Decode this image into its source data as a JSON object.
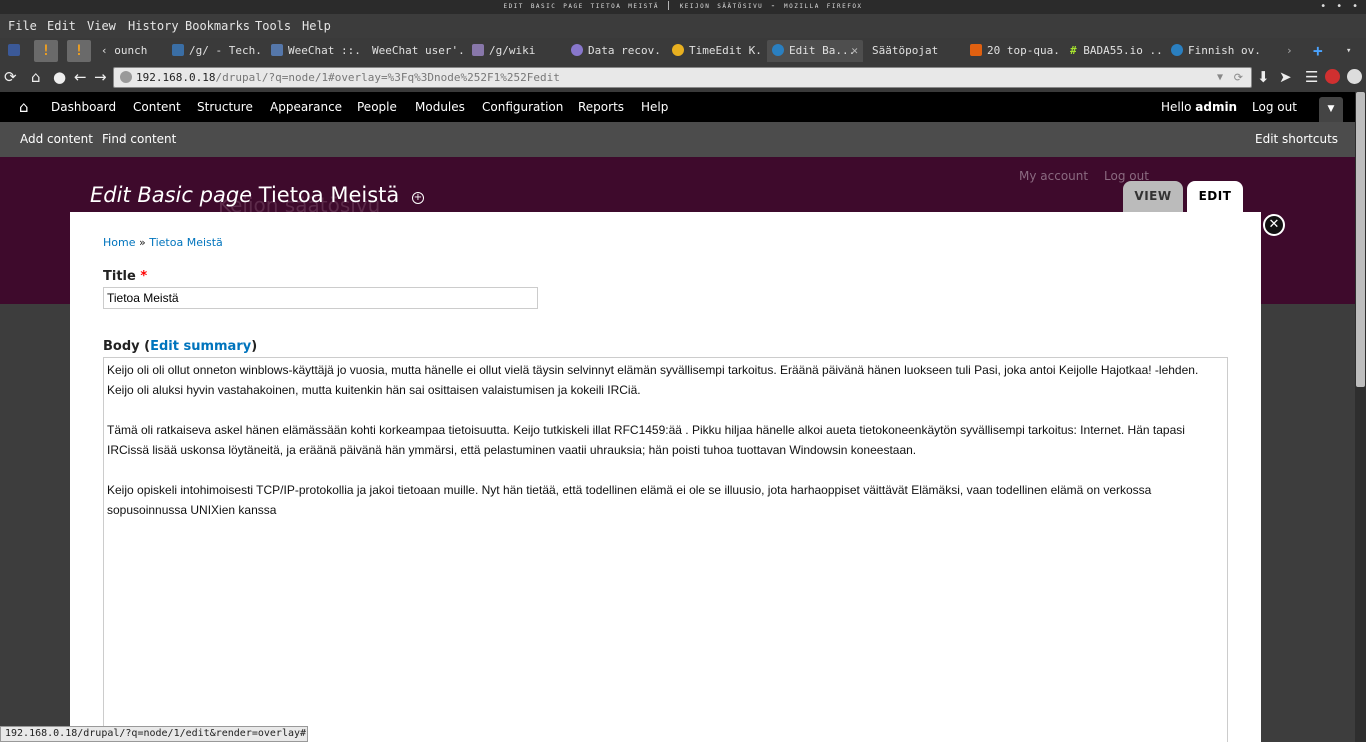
{
  "window": {
    "title": "edit basic page tietoa meistä | keijon säätösivu - mozilla firefox"
  },
  "menubar": [
    "File",
    "Edit",
    "View",
    "History",
    "Bookmarks",
    "Tools",
    "Help"
  ],
  "tabs": [
    {
      "label": "ounch"
    },
    {
      "label": "/g/ - Tech..."
    },
    {
      "label": "WeeChat ::..."
    },
    {
      "label": "WeeChat user'..."
    },
    {
      "label": "/g/wiki"
    },
    {
      "label": "Data recov..."
    },
    {
      "label": "TimeEdit K..."
    },
    {
      "label": "Edit Ba..."
    },
    {
      "label": "Säätöpojat"
    },
    {
      "label": "20 top-qua..."
    },
    {
      "label": "BADA55.io ..."
    },
    {
      "label": "Finnish ov..."
    }
  ],
  "url": {
    "host": "192.168.0.18",
    "path": "/drupal/?q=node/1#overlay=%3Fq%3Dnode%252F1%252Fedit"
  },
  "toolbar": {
    "items": [
      "Dashboard",
      "Content",
      "Structure",
      "Appearance",
      "People",
      "Modules",
      "Configuration",
      "Reports",
      "Help"
    ],
    "hello": "Hello",
    "user": "admin",
    "logout": "Log out"
  },
  "shortcuts": {
    "items": [
      "Add content",
      "Find content"
    ],
    "edit": "Edit shortcuts"
  },
  "header": {
    "type": "Edit Basic page",
    "title": "Tietoa Meistä",
    "site_name": "Keijon säätösivu",
    "my_account": "My account",
    "logout": "Log out",
    "view_tab": "VIEW",
    "edit_tab": "EDIT"
  },
  "breadcrumb": {
    "home": "Home",
    "sep": " » ",
    "current": "Tietoa Meistä"
  },
  "form": {
    "title_label": "Title",
    "required": "*",
    "title_value": "Tietoa Meistä",
    "body_label": "Body",
    "edit_summary": "Edit summary",
    "body": [
      "Keijo oli oli ollut onneton winblows-käyttäjä jo vuosia, mutta hänelle ei ollut vielä täysin selvinnyt elämän syvällisempi tarkoitus. Eräänä päivänä hänen luokseen tuli Pasi, joka antoi Keijolle Hajotkaa! -lehden. Keijo oli aluksi hyvin vastahakoinen, mutta kuitenkin hän sai osittaisen valaistumisen ja kokeili IRCiä.",
      "Tämä oli ratkaiseva askel hänen elämässään kohti korkeampaa tietoisuutta. Keijo tutkiskeli illat RFC1459:ää . Pikku hiljaa hänelle alkoi aueta tietokoneenkäytön syvällisempi tarkoitus: Internet. Hän tapasi IRCissä lisää uskonsa löytäneitä, ja eräänä päivänä hän ymmärsi, että pelastuminen vaatii uhrauksia; hän poisti tuhoa tuottavan Windowsin koneestaan.",
      "Keijo opiskeli intohimoisesti TCP/IP-protokollia ja jakoi tietoaan muille. Nyt hän tietää, että todellinen elämä ei ole se illuusio, jota harhaoppiset väittävät Elämäksi, vaan todellinen elämä on verkossa sopusoinnussa UNIXien kanssa"
    ]
  },
  "statusbar": "192.168.0.18/drupal/?q=node/1/edit&render=overlay#",
  "colors": {
    "toolbar": "#000000",
    "header": "#3e0a2c",
    "link": "#0074bd",
    "required": "#ff0000"
  }
}
